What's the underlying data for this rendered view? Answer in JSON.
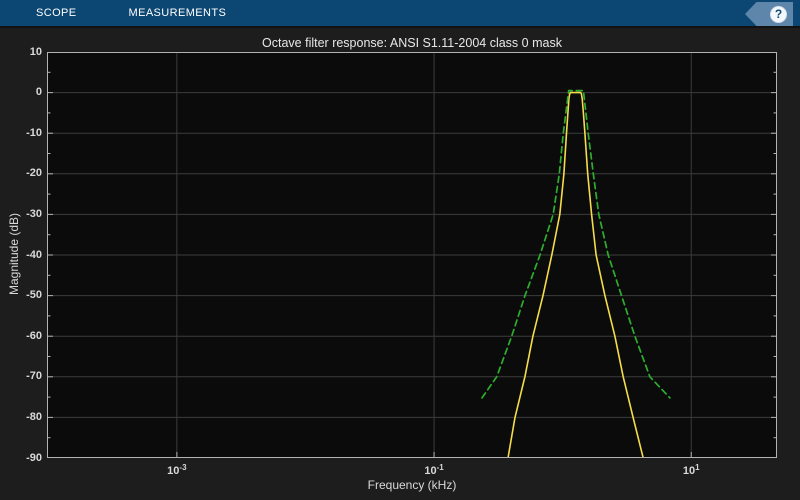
{
  "toolbar": {
    "tabs": [
      {
        "label": "SCOPE"
      },
      {
        "label": "MEASUREMENTS"
      }
    ],
    "help_icon": "?"
  },
  "title": "Octave filter response: ANSI S1.11-2004 class 0 mask",
  "axes": {
    "xlabel": "Frequency (kHz)",
    "ylabel": "Magnitude (dB)",
    "xticks": [
      {
        "base": "10",
        "exp": "-3",
        "value_log": -3
      },
      {
        "base": "10",
        "exp": "-1",
        "value_log": -1
      },
      {
        "base": "10",
        "exp": "1",
        "value_log": 1
      }
    ],
    "yticks": [
      "10",
      "0",
      "-10",
      "-20",
      "-30",
      "-40",
      "-50",
      "-60",
      "-70",
      "-80",
      "-90"
    ]
  },
  "colors": {
    "toolbar_blue": "#0c4673",
    "help_tag_blue": "#5e86aa",
    "figure_bg": "#1d1d1d",
    "axes_bg": "#0b0b0b",
    "grid": "#3c3c3c",
    "axes_box": "#b3b3b3",
    "tick_text": "#d9d9d9",
    "response_yellow": "#f6dc4b",
    "mask_green": "#2eae2e"
  },
  "chart_data": {
    "type": "line",
    "title": "Octave filter response: ANSI S1.11-2004 class 0 mask",
    "xlabel": "Frequency (kHz)",
    "ylabel": "Magnitude (dB)",
    "x_scale": "log",
    "xlim_log": [
      -4.01,
      1.667
    ],
    "ylim": [
      -90,
      10
    ],
    "grid": true,
    "legend": "none",
    "series": [
      {
        "name": "octave-filter-response",
        "color": "#f6dc4b",
        "style": "solid",
        "width": 1.6,
        "points": [
          [
            0.376,
            -90
          ],
          [
            0.426,
            -80
          ],
          [
            0.509,
            -70
          ],
          [
            0.587,
            -60
          ],
          [
            0.703,
            -50
          ],
          [
            0.823,
            -40
          ],
          [
            0.95,
            -30
          ],
          [
            1.022,
            -20
          ],
          [
            1.072,
            -10
          ],
          [
            1.098,
            -5
          ],
          [
            1.118,
            -1.5
          ],
          [
            1.135,
            -0.3
          ],
          [
            1.15,
            0
          ],
          [
            1.38,
            0
          ],
          [
            1.4,
            -0.3
          ],
          [
            1.42,
            -1.5
          ],
          [
            1.45,
            -5
          ],
          [
            1.49,
            -10
          ],
          [
            1.565,
            -20
          ],
          [
            1.68,
            -30
          ],
          [
            1.82,
            -40
          ],
          [
            2.13,
            -50
          ],
          [
            2.55,
            -60
          ],
          [
            2.96,
            -70
          ],
          [
            3.53,
            -80
          ],
          [
            4.23,
            -90
          ]
        ]
      },
      {
        "name": "ansi-s1-11-class0-mask",
        "color": "#2eae2e",
        "style": "dashed",
        "width": 1.7,
        "points": [
          [
            0.236,
            -75.2
          ],
          [
            0.307,
            -70
          ],
          [
            0.402,
            -60
          ],
          [
            0.51,
            -50
          ],
          [
            0.667,
            -40
          ],
          [
            0.845,
            -30
          ],
          [
            0.942,
            -20
          ],
          [
            1.012,
            -10
          ],
          [
            1.115,
            0.5
          ],
          [
            1.45,
            0.5
          ],
          [
            1.58,
            -10
          ],
          [
            1.73,
            -20
          ],
          [
            1.91,
            -30
          ],
          [
            2.26,
            -40
          ],
          [
            2.87,
            -50
          ],
          [
            3.65,
            -60
          ],
          [
            4.77,
            -70
          ],
          [
            6.82,
            -75.2
          ]
        ]
      }
    ]
  }
}
